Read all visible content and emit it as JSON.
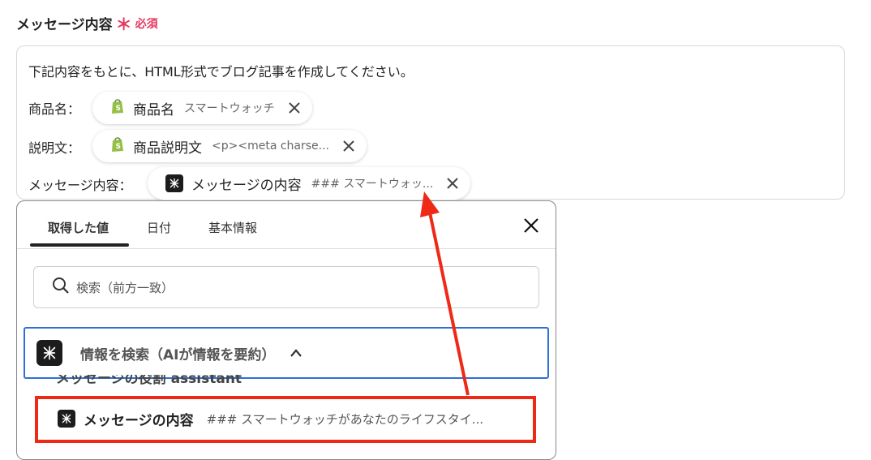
{
  "field": {
    "label": "メッセージ内容",
    "asterisk": "＊",
    "required": "必須"
  },
  "editor": {
    "line1": "下記内容をもとに、HTML形式でブログ記事を作成してください。",
    "rows": [
      {
        "label": "商品名：",
        "chip_label": "商品名",
        "chip_value": "スマートウォッチ",
        "icon": "shopify-icon"
      },
      {
        "label": "説明文：",
        "chip_label": "商品説明文",
        "chip_value": "<p><meta charse...",
        "icon": "shopify-icon"
      },
      {
        "label": "メッセージ内容：",
        "chip_label": "メッセージの内容",
        "chip_value": "### スマートウォッ...",
        "icon": "ai-app-icon"
      }
    ]
  },
  "dropdown": {
    "tabs": [
      "取得した値",
      "日付",
      "基本情報"
    ],
    "active_tab": 0,
    "search_placeholder": "検索（前方一致）",
    "section_title": "情報を検索（AIが情報を要約）",
    "partial_item": "メッセージの役割 assistant",
    "item": {
      "label": "メッセージの内容",
      "value": "### スマートウォッチがあなたのライフスタイ..."
    }
  },
  "colors": {
    "accent_blue": "#2e6fd6",
    "highlight_red": "#ee2a17",
    "required_pink": "#e3395f",
    "shopify_green": "#95bf47"
  }
}
